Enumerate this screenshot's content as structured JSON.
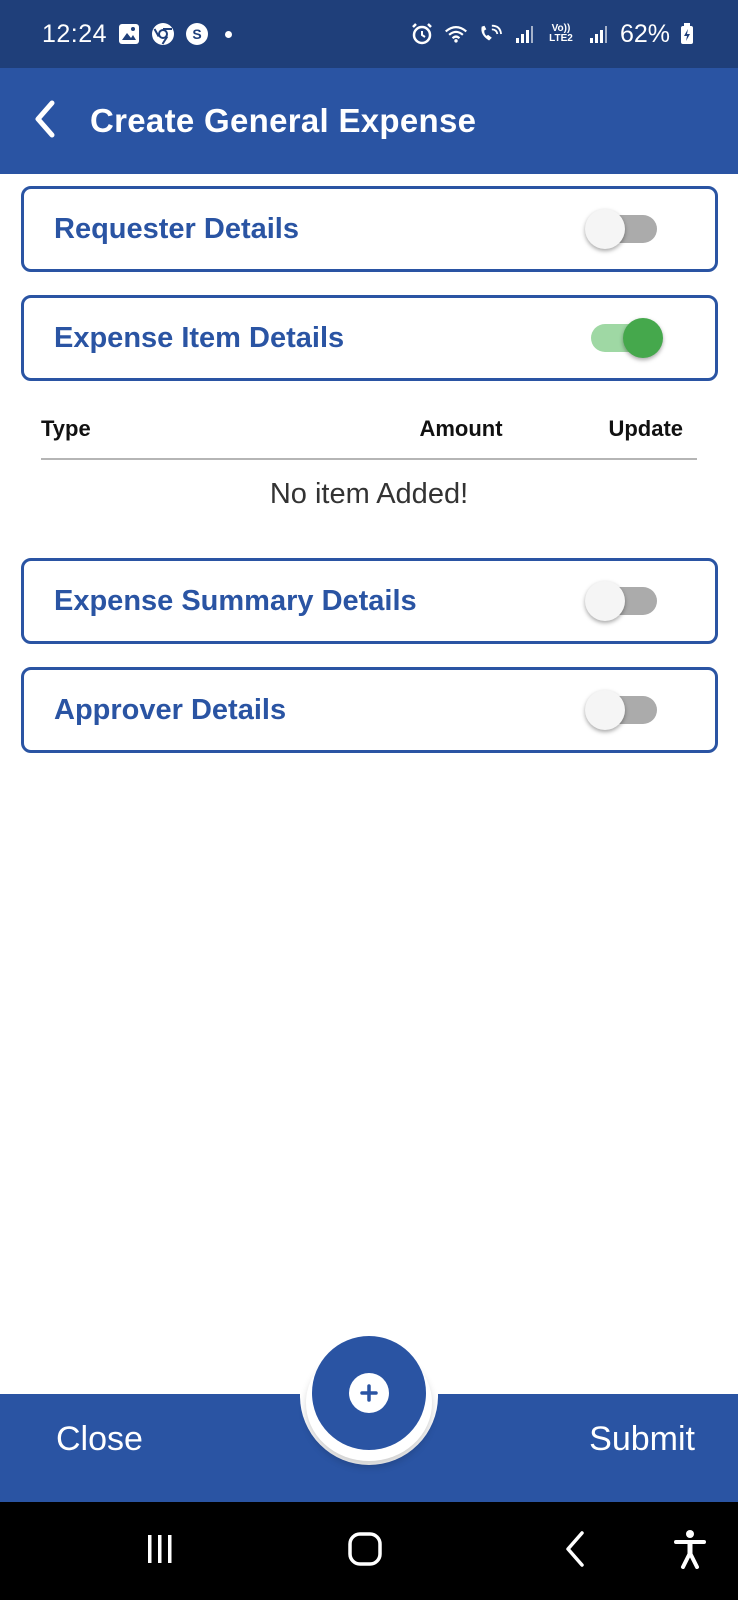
{
  "status_bar": {
    "time": "12:24",
    "battery": "62%",
    "lte_label_top": "Vo))",
    "lte_label_bottom": "LTE2",
    "icons": [
      "gallery-icon",
      "chrome-icon",
      "s-app-icon",
      "alarm-icon",
      "wifi-icon",
      "wifi-calling-icon",
      "signal-icon",
      "signal-icon",
      "battery-icon"
    ]
  },
  "header": {
    "title": "Create General Expense",
    "back_icon": "chevron-left-icon"
  },
  "sections": [
    {
      "label": "Requester Details",
      "toggle_on": false
    },
    {
      "label": "Expense Item Details",
      "toggle_on": true
    },
    {
      "label": "Expense Summary Details",
      "toggle_on": false
    },
    {
      "label": "Approver Details",
      "toggle_on": false
    }
  ],
  "items_table": {
    "columns": [
      "Type",
      "Amount",
      "Update"
    ],
    "rows": [],
    "empty_message": "No item Added!"
  },
  "bottom_bar": {
    "close_label": "Close",
    "submit_label": "Submit",
    "fab_icon": "plus-icon"
  },
  "nav_bar": {
    "icons": [
      "recents-icon",
      "home-icon",
      "back-icon",
      "accessibility-icon"
    ]
  },
  "colors": {
    "primary": "#2a54a3",
    "status_bar": "#1f3f7a",
    "toggle_on": "#45a84c",
    "toggle_off": "#ababab"
  }
}
